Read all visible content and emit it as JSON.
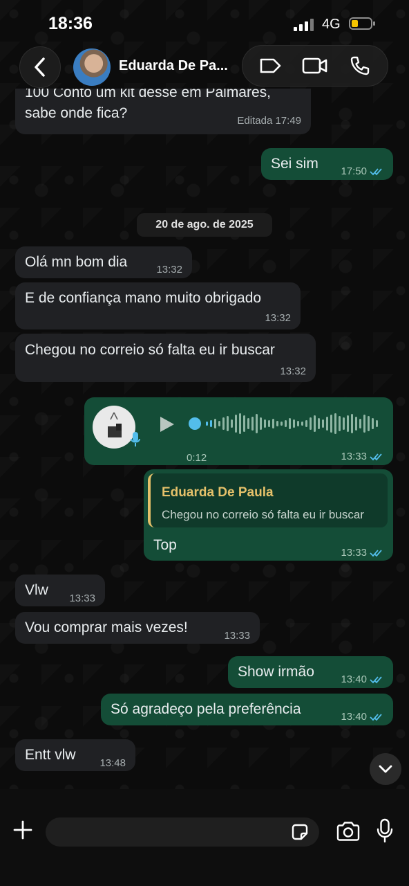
{
  "status_bar": {
    "time": "18:36",
    "network": "4G"
  },
  "header": {
    "contact_name": "Eduarda De Pa..."
  },
  "messages": [
    {
      "id": "m0",
      "direction": "in",
      "text_line1": "100 Conto um kit desse em Palmares,",
      "text_line2": "sabe onde fica?",
      "time": "Editada 17:49"
    },
    {
      "id": "m1",
      "direction": "out",
      "text": "Sei sim",
      "time": "17:50",
      "read": true
    },
    {
      "id": "m3",
      "direction": "in",
      "text": "Olá mn bom dia",
      "time": "13:32"
    },
    {
      "id": "m4",
      "direction": "in",
      "text": "E de confiança mano muito obrigado",
      "time": "13:32"
    },
    {
      "id": "m5",
      "direction": "in",
      "text": "Chegou no correio só falta eu ir buscar",
      "time": "13:32"
    },
    {
      "id": "m6",
      "direction": "out",
      "type": "voice",
      "duration": "0:12",
      "time": "13:33",
      "read": true
    },
    {
      "id": "m7",
      "direction": "out",
      "type": "reply",
      "quote_author": "Eduarda De Paula",
      "quote_text": "Chegou no correio só falta eu ir buscar",
      "text": "Top",
      "time": "13:33",
      "read": true
    },
    {
      "id": "m8",
      "direction": "in",
      "text": "Vlw",
      "time": "13:33"
    },
    {
      "id": "m9",
      "direction": "in",
      "text": "Vou comprar mais vezes!",
      "time": "13:33"
    },
    {
      "id": "m10",
      "direction": "out",
      "text": "Show irmão",
      "time": "13:40",
      "read": true
    },
    {
      "id": "m11",
      "direction": "out",
      "text": "Só agradeço pela preferência",
      "time": "13:40",
      "read": true
    },
    {
      "id": "m12",
      "direction": "in",
      "text": "Entt vlw",
      "time": "13:48"
    }
  ],
  "date_separator": "20 de ago. de 2025",
  "composer": {
    "placeholder": ""
  },
  "colors": {
    "outgoing": "#144d37",
    "incoming": "#202124",
    "read_ticks": "#53bdeb",
    "quote_accent": "#e5c16a",
    "battery": "#f5c400"
  },
  "icons": [
    "back-chevron-icon",
    "label-tag-icon",
    "video-call-icon",
    "phone-icon",
    "play-icon",
    "mic-badge-icon",
    "read-ticks-icon",
    "chevron-down-icon",
    "plus-icon",
    "sticker-icon",
    "camera-icon",
    "mic-icon"
  ]
}
